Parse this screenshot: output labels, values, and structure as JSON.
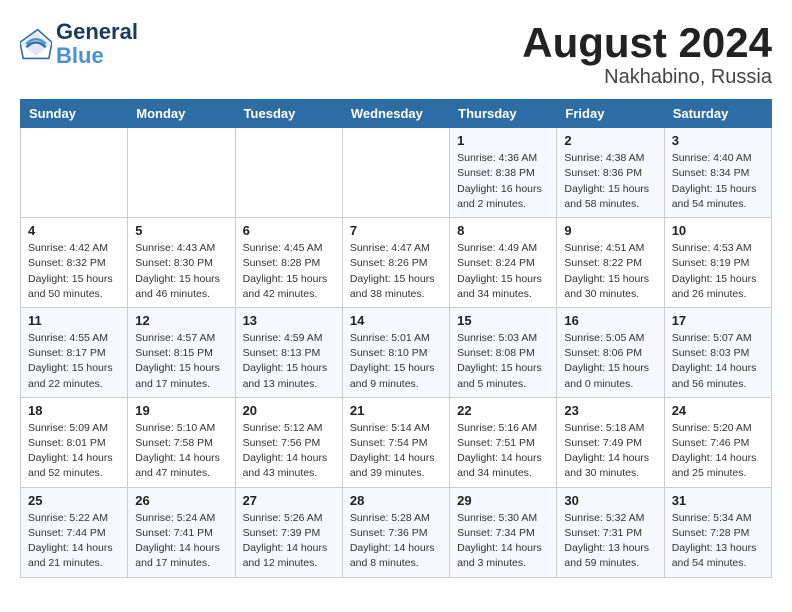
{
  "header": {
    "logo_line1": "General",
    "logo_line2": "Blue",
    "month_year": "August 2024",
    "location": "Nakhabino, Russia"
  },
  "weekdays": [
    "Sunday",
    "Monday",
    "Tuesday",
    "Wednesday",
    "Thursday",
    "Friday",
    "Saturday"
  ],
  "weeks": [
    [
      {
        "day": "",
        "detail": ""
      },
      {
        "day": "",
        "detail": ""
      },
      {
        "day": "",
        "detail": ""
      },
      {
        "day": "",
        "detail": ""
      },
      {
        "day": "1",
        "detail": "Sunrise: 4:36 AM\nSunset: 8:38 PM\nDaylight: 16 hours\nand 2 minutes."
      },
      {
        "day": "2",
        "detail": "Sunrise: 4:38 AM\nSunset: 8:36 PM\nDaylight: 15 hours\nand 58 minutes."
      },
      {
        "day": "3",
        "detail": "Sunrise: 4:40 AM\nSunset: 8:34 PM\nDaylight: 15 hours\nand 54 minutes."
      }
    ],
    [
      {
        "day": "4",
        "detail": "Sunrise: 4:42 AM\nSunset: 8:32 PM\nDaylight: 15 hours\nand 50 minutes."
      },
      {
        "day": "5",
        "detail": "Sunrise: 4:43 AM\nSunset: 8:30 PM\nDaylight: 15 hours\nand 46 minutes."
      },
      {
        "day": "6",
        "detail": "Sunrise: 4:45 AM\nSunset: 8:28 PM\nDaylight: 15 hours\nand 42 minutes."
      },
      {
        "day": "7",
        "detail": "Sunrise: 4:47 AM\nSunset: 8:26 PM\nDaylight: 15 hours\nand 38 minutes."
      },
      {
        "day": "8",
        "detail": "Sunrise: 4:49 AM\nSunset: 8:24 PM\nDaylight: 15 hours\nand 34 minutes."
      },
      {
        "day": "9",
        "detail": "Sunrise: 4:51 AM\nSunset: 8:22 PM\nDaylight: 15 hours\nand 30 minutes."
      },
      {
        "day": "10",
        "detail": "Sunrise: 4:53 AM\nSunset: 8:19 PM\nDaylight: 15 hours\nand 26 minutes."
      }
    ],
    [
      {
        "day": "11",
        "detail": "Sunrise: 4:55 AM\nSunset: 8:17 PM\nDaylight: 15 hours\nand 22 minutes."
      },
      {
        "day": "12",
        "detail": "Sunrise: 4:57 AM\nSunset: 8:15 PM\nDaylight: 15 hours\nand 17 minutes."
      },
      {
        "day": "13",
        "detail": "Sunrise: 4:59 AM\nSunset: 8:13 PM\nDaylight: 15 hours\nand 13 minutes."
      },
      {
        "day": "14",
        "detail": "Sunrise: 5:01 AM\nSunset: 8:10 PM\nDaylight: 15 hours\nand 9 minutes."
      },
      {
        "day": "15",
        "detail": "Sunrise: 5:03 AM\nSunset: 8:08 PM\nDaylight: 15 hours\nand 5 minutes."
      },
      {
        "day": "16",
        "detail": "Sunrise: 5:05 AM\nSunset: 8:06 PM\nDaylight: 15 hours\nand 0 minutes."
      },
      {
        "day": "17",
        "detail": "Sunrise: 5:07 AM\nSunset: 8:03 PM\nDaylight: 14 hours\nand 56 minutes."
      }
    ],
    [
      {
        "day": "18",
        "detail": "Sunrise: 5:09 AM\nSunset: 8:01 PM\nDaylight: 14 hours\nand 52 minutes."
      },
      {
        "day": "19",
        "detail": "Sunrise: 5:10 AM\nSunset: 7:58 PM\nDaylight: 14 hours\nand 47 minutes."
      },
      {
        "day": "20",
        "detail": "Sunrise: 5:12 AM\nSunset: 7:56 PM\nDaylight: 14 hours\nand 43 minutes."
      },
      {
        "day": "21",
        "detail": "Sunrise: 5:14 AM\nSunset: 7:54 PM\nDaylight: 14 hours\nand 39 minutes."
      },
      {
        "day": "22",
        "detail": "Sunrise: 5:16 AM\nSunset: 7:51 PM\nDaylight: 14 hours\nand 34 minutes."
      },
      {
        "day": "23",
        "detail": "Sunrise: 5:18 AM\nSunset: 7:49 PM\nDaylight: 14 hours\nand 30 minutes."
      },
      {
        "day": "24",
        "detail": "Sunrise: 5:20 AM\nSunset: 7:46 PM\nDaylight: 14 hours\nand 25 minutes."
      }
    ],
    [
      {
        "day": "25",
        "detail": "Sunrise: 5:22 AM\nSunset: 7:44 PM\nDaylight: 14 hours\nand 21 minutes."
      },
      {
        "day": "26",
        "detail": "Sunrise: 5:24 AM\nSunset: 7:41 PM\nDaylight: 14 hours\nand 17 minutes."
      },
      {
        "day": "27",
        "detail": "Sunrise: 5:26 AM\nSunset: 7:39 PM\nDaylight: 14 hours\nand 12 minutes."
      },
      {
        "day": "28",
        "detail": "Sunrise: 5:28 AM\nSunset: 7:36 PM\nDaylight: 14 hours\nand 8 minutes."
      },
      {
        "day": "29",
        "detail": "Sunrise: 5:30 AM\nSunset: 7:34 PM\nDaylight: 14 hours\nand 3 minutes."
      },
      {
        "day": "30",
        "detail": "Sunrise: 5:32 AM\nSunset: 7:31 PM\nDaylight: 13 hours\nand 59 minutes."
      },
      {
        "day": "31",
        "detail": "Sunrise: 5:34 AM\nSunset: 7:28 PM\nDaylight: 13 hours\nand 54 minutes."
      }
    ]
  ]
}
